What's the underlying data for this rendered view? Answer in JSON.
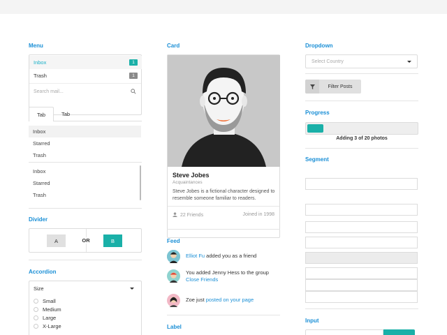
{
  "menu": {
    "title": "Menu",
    "items": [
      {
        "label": "Inbox",
        "count": "1"
      },
      {
        "label": "Trash",
        "count": "1"
      }
    ],
    "search_placeholder": "Search mail..."
  },
  "tabs": {
    "labels": [
      "Tab",
      "Tab"
    ],
    "list_a": [
      "Inbox",
      "Starred",
      "Trash"
    ],
    "list_b": [
      "Inbox",
      "Starred",
      "Trash"
    ]
  },
  "divider": {
    "title": "Divider",
    "left": "A",
    "middle": "OR",
    "right": "B"
  },
  "accordion": {
    "title": "Accordion",
    "header": "Size",
    "options": [
      "Small",
      "Medium",
      "Large",
      "X-Large"
    ]
  },
  "card": {
    "title": "Card",
    "name": "Steve Jobes",
    "meta": "Acquaintances",
    "description": "Steve Jobes is a fictional character designed to resemble someone familiar to readers.",
    "friends": "22 Friends",
    "joined": "Joined in 1998"
  },
  "feed": {
    "title": "Feed",
    "items": [
      {
        "link": "Elliot Fu",
        "text": " added you as a friend"
      },
      {
        "text": "You added Jenny Hess to the group",
        "link": "Close Friends"
      },
      {
        "text": "Zoe just ",
        "link": "posted on your page"
      }
    ]
  },
  "label": {
    "title": "Label"
  },
  "dropdown": {
    "title": "Dropdown",
    "placeholder": "Select Country",
    "filter_label": "Filter Posts"
  },
  "progress": {
    "title": "Progress",
    "value": 0.15,
    "caption": "Adding 3 of 20 photos",
    "color": "#1ab0a8"
  },
  "segment": {
    "title": "Segment"
  },
  "input": {
    "title": "Input"
  },
  "colors": {
    "accent": "#1a8fd6",
    "teal": "#1ab0a8"
  }
}
